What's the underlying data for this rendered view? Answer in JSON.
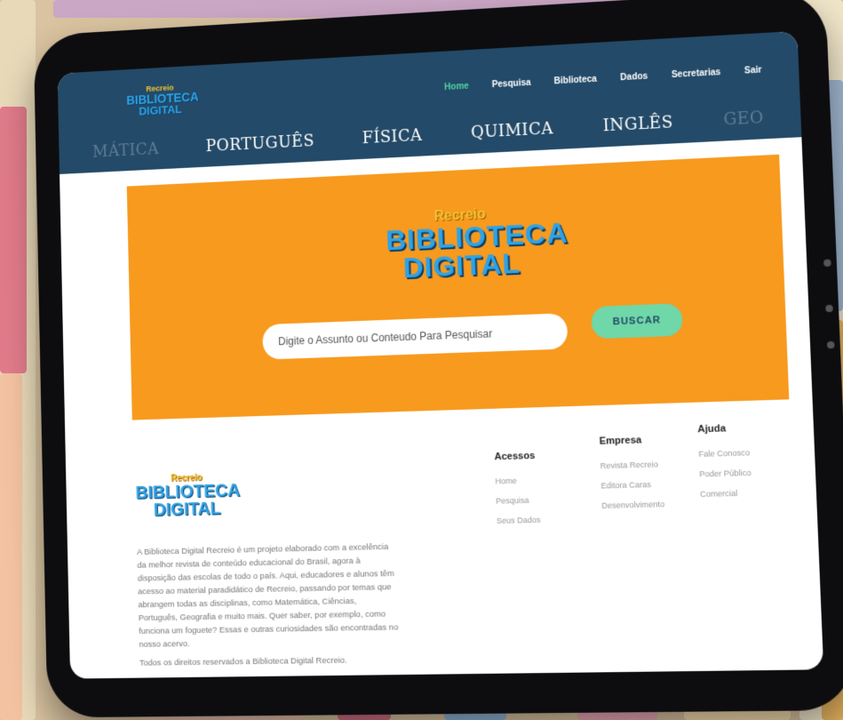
{
  "brand": {
    "line1": "Recreio",
    "line2": "BIBLIOTECA",
    "line3": "DIGITAL"
  },
  "nav": {
    "items": [
      "Home",
      "Pesquisa",
      "Biblioteca",
      "Dados",
      "Secretarias",
      "Sair"
    ],
    "active": "Home"
  },
  "subjects": [
    "MÁTICA",
    "PORTUGUÊS",
    "FÍSICA",
    "QUIMICA",
    "INGLÊS",
    "GEO"
  ],
  "hero": {
    "search_placeholder": "Digite o Assunto ou Conteudo Para Pesquisar",
    "button_label": "BUSCAR"
  },
  "footer": {
    "about": "A Biblioteca Digital Recreio é um projeto elaborado com a excelência da melhor revista de conteúdo educacional do Brasil, agora à disposição das escolas de todo o país. Aqui, educadores e alunos têm acesso ao material paradidático de Recreio, passando por temas que abrangem todas as disciplinas, como Matemática, Ciências, Português, Geografia e muito mais. Quer saber, por exemplo, como funciona um foguete? Essas e outras curiosidades são encontradas no nosso acervo.",
    "rights": "Todos os direitos reservados a Biblioteca Digital Recreio.",
    "columns": [
      {
        "title": "Acessos",
        "links": [
          "Home",
          "Pesquisa",
          "Seus Dados"
        ]
      },
      {
        "title": "Empresa",
        "links": [
          "Revista Recreio",
          "Editora Caras",
          "Desenvolvimento"
        ]
      },
      {
        "title": "Ajuda",
        "links": [
          "Fale Conosco",
          "Poder Público",
          "Comercial"
        ]
      }
    ]
  },
  "colors": {
    "header": "#234a68",
    "hero": "#f79a1e",
    "button": "#6fd7a8",
    "active_nav": "#4fd6a0"
  }
}
